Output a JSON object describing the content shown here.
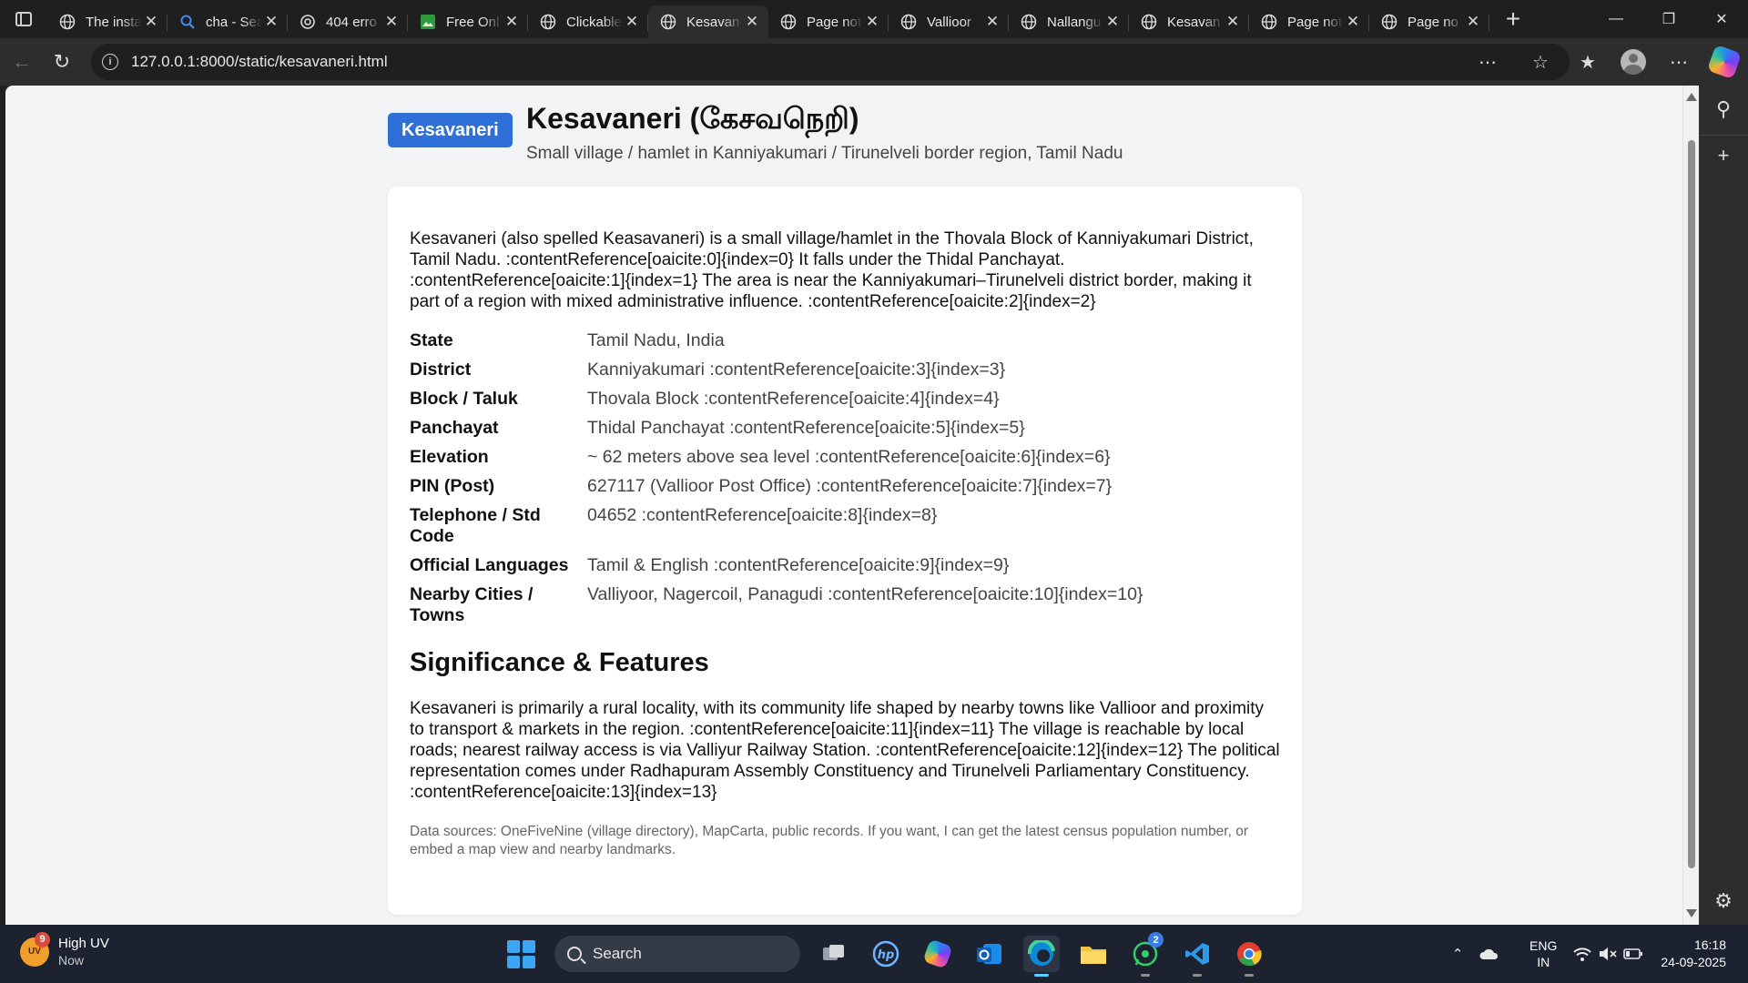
{
  "browser": {
    "tabs": [
      {
        "title": "The insta",
        "icon": "globe-icon",
        "active": false
      },
      {
        "title": "cha - Sea",
        "icon": "search-icon",
        "active": false
      },
      {
        "title": "404 erro",
        "icon": "openai-icon",
        "active": false
      },
      {
        "title": "Free Onl",
        "icon": "image-editor-icon",
        "active": false
      },
      {
        "title": "Clickable",
        "icon": "globe-icon",
        "active": false
      },
      {
        "title": "Kesavan",
        "icon": "globe-icon",
        "active": true
      },
      {
        "title": "Page not",
        "icon": "globe-icon",
        "active": false
      },
      {
        "title": "Vallioor",
        "icon": "globe-icon",
        "active": false
      },
      {
        "title": "Nallangu",
        "icon": "globe-icon",
        "active": false
      },
      {
        "title": "Kesavan",
        "icon": "globe-icon",
        "active": false
      },
      {
        "title": "Page not",
        "icon": "globe-icon",
        "active": false
      },
      {
        "title": "Page no",
        "icon": "globe-icon",
        "active": false
      }
    ],
    "url": "127.0.0.1:8000/static/kesavaneri.html"
  },
  "page": {
    "brand": "Kesavaneri",
    "title": "Kesavaneri (கேசவநெறி)",
    "subtitle": "Small village / hamlet in Kanniyakumari / Tirunelveli border region, Tamil Nadu",
    "intro": "Kesavaneri (also spelled Keasavaneri) is a small village/hamlet in the Thovala Block of Kanniyakumari District, Tamil Nadu. :contentReference[oaicite:0]{index=0} It falls under the Thidal Panchayat. :contentReference[oaicite:1]{index=1} The area is near the Kanniyakumari–Tirunelveli district border, making it part of a region with mixed administrative influence. :contentReference[oaicite:2]{index=2}",
    "facts": [
      {
        "label": "State",
        "value": "Tamil Nadu, India"
      },
      {
        "label": "District",
        "value": "Kanniyakumari :contentReference[oaicite:3]{index=3}"
      },
      {
        "label": "Block / Taluk",
        "value": "Thovala Block :contentReference[oaicite:4]{index=4}"
      },
      {
        "label": "Panchayat",
        "value": "Thidal Panchayat :contentReference[oaicite:5]{index=5}"
      },
      {
        "label": "Elevation",
        "value": "~ 62 meters above sea level :contentReference[oaicite:6]{index=6}"
      },
      {
        "label": "PIN (Post)",
        "value": "627117 (Vallioor Post Office) :contentReference[oaicite:7]{index=7}"
      },
      {
        "label": "Telephone / Std Code",
        "value": "04652 :contentReference[oaicite:8]{index=8}"
      },
      {
        "label": "Official Languages",
        "value": "Tamil & English :contentReference[oaicite:9]{index=9}"
      },
      {
        "label": "Nearby Cities / Towns",
        "value": "Valliyoor, Nagercoil, Panagudi :contentReference[oaicite:10]{index=10}"
      }
    ],
    "section_title": "Significance & Features",
    "section_body": "Kesavaneri is primarily a rural locality, with its community life shaped by nearby towns like Vallioor and proximity to transport & markets in the region. :contentReference[oaicite:11]{index=11} The village is reachable by local roads; nearest railway access is via Valliyur Railway Station. :contentReference[oaicite:12]{index=12} The political representation comes under Radhapuram Assembly Constituency and Tirunelveli Parliamentary Constituency. :contentReference[oaicite:13]{index=13}",
    "sources": "Data sources: OneFiveNine (village directory), MapCarta, public records. If you want, I can get the latest census population number, or embed a map view and nearby landmarks."
  },
  "taskbar": {
    "weather_title": "High UV",
    "weather_sub": "Now",
    "weather_badge": "9",
    "weather_icon_text": "UV",
    "search_label": "Search",
    "whatsapp_badge": "2",
    "lang_top": "ENG",
    "lang_bottom": "IN",
    "time": "16:18",
    "date": "24-09-2025"
  },
  "colors": {
    "brand": "#2f6fd8",
    "page_bg": "#f2f3f5",
    "card_bg": "#ffffff",
    "browser_dark": "#1f1f1f",
    "taskbar": "#1c2230"
  }
}
